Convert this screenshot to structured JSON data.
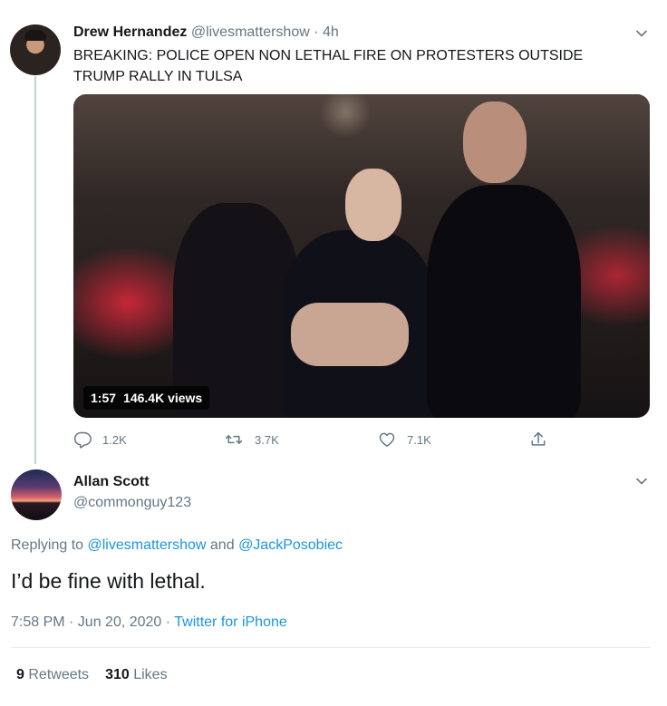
{
  "colors": {
    "accent": "#1b95e0",
    "secondary_text": "#657786",
    "primary_text": "#14171a"
  },
  "tweet": {
    "author_name": "Drew Hernandez",
    "author_handle": "@livesmattershow",
    "separator": "·",
    "time": "4h",
    "text": "BREAKING: POLICE OPEN NON LETHAL FIRE ON PROTESTERS OUTSIDE TRUMP RALLY IN TULSA",
    "video": {
      "duration": "1:57",
      "views": "146.4K views"
    },
    "actions": {
      "reply_count": "1.2K",
      "retweet_count": "3.7K",
      "like_count": "7.1K"
    },
    "icons": {
      "reply": "reply-icon",
      "retweet": "retweet-icon",
      "like": "heart-icon",
      "share": "share-icon",
      "more": "chevron-down-icon"
    }
  },
  "reply": {
    "author_name": "Allan Scott",
    "author_handle": "@commonguy123",
    "replying_prefix": "Replying to",
    "replying_to_1": "@livesmattershow",
    "replying_and": "and",
    "replying_to_2": "@JackPosobiec",
    "text": "I’d be fine with lethal.",
    "timestamp": "7:58 PM · Jun 20, 2020 ·",
    "client": "Twitter for iPhone",
    "retweets_count": "9",
    "retweets_label": "Retweets",
    "likes_count": "310",
    "likes_label": "Likes"
  }
}
